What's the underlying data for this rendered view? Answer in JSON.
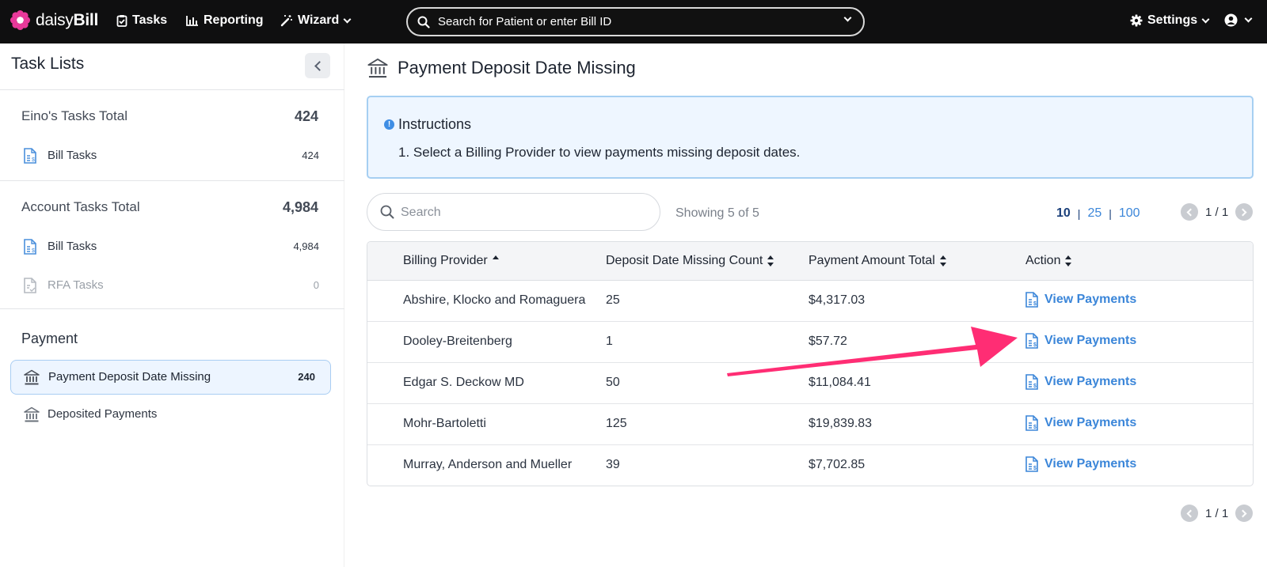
{
  "topnav": {
    "logo_part1": "daisy",
    "logo_part2": "Bill",
    "tasks": "Tasks",
    "reporting": "Reporting",
    "wizard": "Wizard",
    "search_placeholder": "Search for Patient or enter Bill ID",
    "settings": "Settings"
  },
  "sidebar": {
    "title": "Task Lists",
    "groups": [
      {
        "title": "Eino's Tasks Total",
        "total": "424",
        "items": [
          {
            "label": "Bill Tasks",
            "count": "424"
          }
        ]
      },
      {
        "title": "Account Tasks Total",
        "total": "4,984",
        "items": [
          {
            "label": "Bill Tasks",
            "count": "4,984"
          },
          {
            "label": "RFA Tasks",
            "count": "0"
          }
        ]
      }
    ],
    "payment": {
      "title": "Payment",
      "items": [
        {
          "label": "Payment Deposit Date Missing",
          "count": "240",
          "active": true
        },
        {
          "label": "Deposited Payments",
          "count": "",
          "active": false
        }
      ]
    }
  },
  "main": {
    "title": "Payment Deposit Date Missing",
    "instructions": {
      "title": "Instructions",
      "lines": [
        "1. Select a Billing Provider to view payments missing deposit dates."
      ]
    },
    "search_placeholder": "Search",
    "showing": "Showing 5 of 5",
    "page_sizes": [
      "10",
      "25",
      "100"
    ],
    "current_page_size": "10",
    "page_indicator": "1 / 1",
    "table": {
      "columns": [
        "Billing Provider",
        "Deposit Date Missing Count",
        "Payment Amount Total",
        "Action"
      ],
      "rows": [
        {
          "provider": "Abshire, Klocko and Romaguera",
          "count": "25",
          "amount": "$4,317.03",
          "action": "View Payments"
        },
        {
          "provider": "Dooley-Breitenberg",
          "count": "1",
          "amount": "$57.72",
          "action": "View Payments"
        },
        {
          "provider": "Edgar S. Deckow MD",
          "count": "50",
          "amount": "$11,084.41",
          "action": "View Payments"
        },
        {
          "provider": "Mohr-Bartoletti",
          "count": "125",
          "amount": "$19,839.83",
          "action": "View Payments"
        },
        {
          "provider": "Murray, Anderson and Mueller",
          "count": "39",
          "amount": "$7,702.85",
          "action": "View Payments"
        }
      ]
    }
  },
  "colors": {
    "nav_bg": "#0f0f10",
    "accent_blue": "#3b86d9",
    "annotation_arrow": "#ff2d74",
    "logo_pink": "#e8399a"
  },
  "icons": {
    "logo": "daisy-flower-icon",
    "tasks": "clipboard-check-icon",
    "reporting": "bar-chart-icon",
    "wizard": "magic-wand-icon",
    "search": "search-icon",
    "settings": "gear-icon",
    "account": "user-circle-icon",
    "bill": "bill-document-icon",
    "bank": "bank-icon"
  }
}
